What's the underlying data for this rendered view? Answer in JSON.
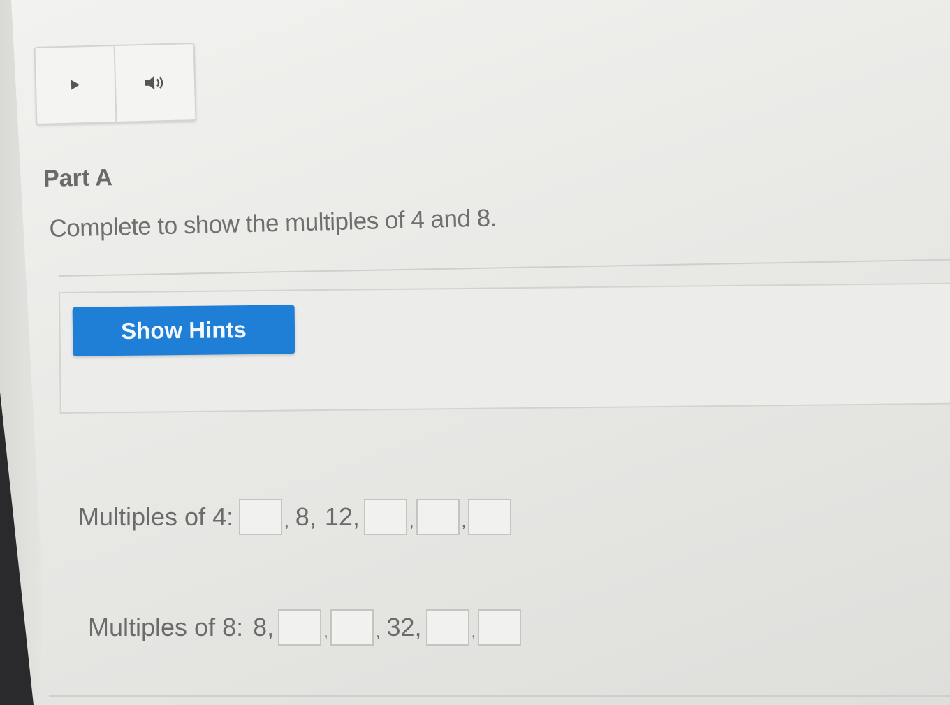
{
  "audio_player": {
    "play_icon": "play-icon",
    "speaker_icon": "speaker-icon"
  },
  "part_label": "Part A",
  "question": "Complete to show the multiples of 4 and 8.",
  "hints": {
    "button_label": "Show Hints",
    "accent_color": "#1f7fd6"
  },
  "multiples_4": {
    "label": "Multiples of 4:",
    "given_1": "8,",
    "given_2": "12,"
  },
  "multiples_8": {
    "label": "Multiples of 8:",
    "given_1": "8,",
    "given_2": "32,"
  },
  "separator": ","
}
